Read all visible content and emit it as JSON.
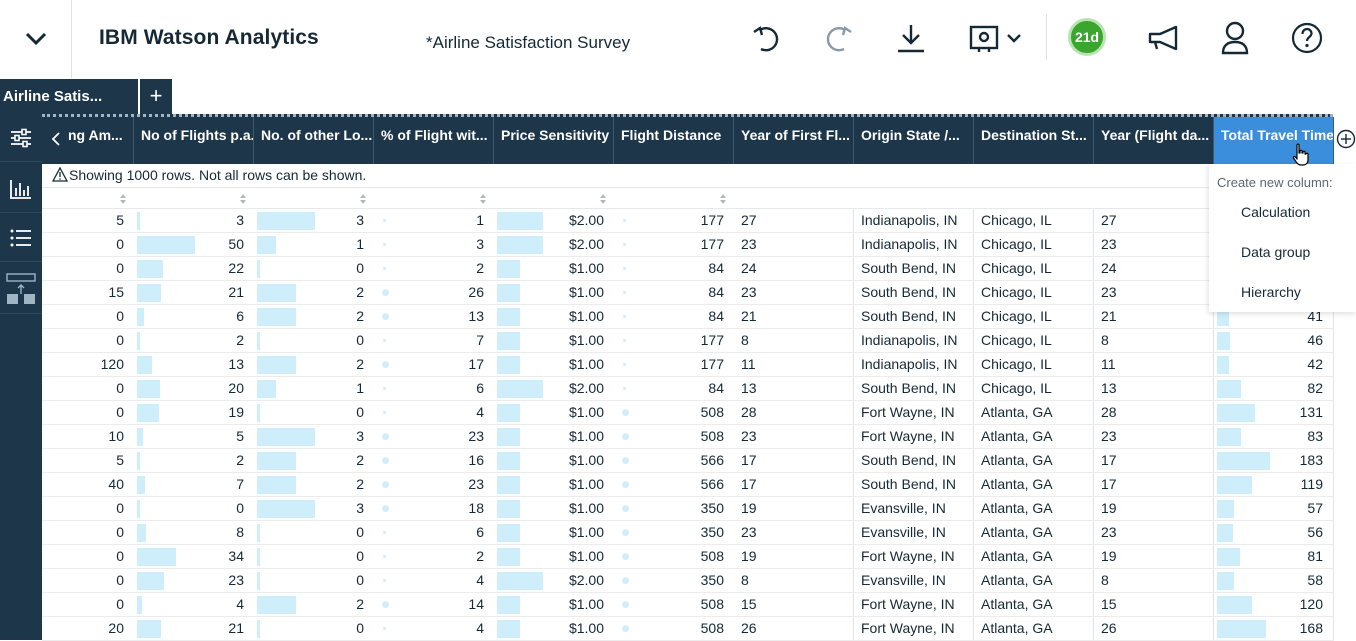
{
  "header": {
    "app_brand": "IBM",
    "app_name": "Watson Analytics",
    "document_title": "*Airline Satisfaction Survey",
    "trial_days": "21d"
  },
  "tabs": {
    "active_label": "Airline Satis...",
    "add_label": "+"
  },
  "grid": {
    "info_message": "Showing 1000 rows. Not all rows can be shown.",
    "columns": [
      "ng Am...",
      "No of Flights p.a.",
      "No. of other Lo...",
      "% of Flight wit...",
      "Price Sensitivity",
      "Flight Distance",
      "Year of First Fl...",
      "Origin State /...",
      "Destination St...",
      "Year (Flight da...",
      "Total Travel Time"
    ],
    "rows": [
      [
        "5",
        "3",
        "3",
        "1",
        "$2.00",
        "177",
        "27",
        "Indianapolis, IN",
        "Chicago, IL",
        "27",
        ""
      ],
      [
        "0",
        "50",
        "1",
        "3",
        "$2.00",
        "177",
        "23",
        "Indianapolis, IN",
        "Chicago, IL",
        "23",
        ""
      ],
      [
        "0",
        "22",
        "0",
        "2",
        "$1.00",
        "84",
        "24",
        "South Bend, IN",
        "Chicago, IL",
        "24",
        ""
      ],
      [
        "15",
        "21",
        "2",
        "26",
        "$1.00",
        "84",
        "23",
        "South Bend, IN",
        "Chicago, IL",
        "23",
        ""
      ],
      [
        "0",
        "6",
        "2",
        "13",
        "$1.00",
        "84",
        "21",
        "South Bend, IN",
        "Chicago, IL",
        "21",
        "41"
      ],
      [
        "0",
        "2",
        "0",
        "7",
        "$1.00",
        "177",
        "8",
        "Indianapolis, IN",
        "Chicago, IL",
        "8",
        "46"
      ],
      [
        "120",
        "13",
        "2",
        "17",
        "$1.00",
        "177",
        "11",
        "Indianapolis, IN",
        "Chicago, IL",
        "11",
        "42"
      ],
      [
        "0",
        "20",
        "1",
        "6",
        "$2.00",
        "84",
        "13",
        "South Bend, IN",
        "Chicago, IL",
        "13",
        "82"
      ],
      [
        "0",
        "19",
        "0",
        "4",
        "$1.00",
        "508",
        "28",
        "Fort Wayne, IN",
        "Atlanta, GA",
        "28",
        "131"
      ],
      [
        "10",
        "5",
        "3",
        "23",
        "$1.00",
        "508",
        "23",
        "Fort Wayne, IN",
        "Atlanta, GA",
        "23",
        "83"
      ],
      [
        "5",
        "2",
        "2",
        "16",
        "$1.00",
        "566",
        "17",
        "South Bend, IN",
        "Atlanta, GA",
        "17",
        "183"
      ],
      [
        "40",
        "7",
        "2",
        "23",
        "$1.00",
        "566",
        "17",
        "South Bend, IN",
        "Atlanta, GA",
        "17",
        "119"
      ],
      [
        "0",
        "0",
        "3",
        "18",
        "$1.00",
        "350",
        "19",
        "Evansville, IN",
        "Atlanta, GA",
        "19",
        "57"
      ],
      [
        "0",
        "8",
        "0",
        "6",
        "$1.00",
        "350",
        "23",
        "Evansville, IN",
        "Atlanta, GA",
        "23",
        "56"
      ],
      [
        "0",
        "34",
        "0",
        "2",
        "$1.00",
        "508",
        "19",
        "Fort Wayne, IN",
        "Atlanta, GA",
        "19",
        "81"
      ],
      [
        "0",
        "23",
        "0",
        "4",
        "$2.00",
        "350",
        "8",
        "Evansville, IN",
        "Atlanta, GA",
        "8",
        "58"
      ],
      [
        "0",
        "4",
        "2",
        "14",
        "$1.00",
        "508",
        "15",
        "Fort Wayne, IN",
        "Atlanta, GA",
        "15",
        "120"
      ],
      [
        "20",
        "21",
        "0",
        "4",
        "$1.00",
        "508",
        "26",
        "Fort Wayne, IN",
        "Atlanta, GA",
        "26",
        "168"
      ]
    ]
  },
  "new_column_menu": {
    "title": "Create new column:",
    "items": [
      "Calculation",
      "Data group",
      "Hierarchy"
    ]
  },
  "colors": {
    "nav_dark": "#1d3649",
    "selected_header": "#3b8edb",
    "bar_fill": "#cdeefa",
    "trial_green": "#3aa52f"
  },
  "icons": {
    "menu": "chevron-down-icon",
    "undo": "undo-icon",
    "redo": "redo-icon",
    "download": "download-icon",
    "present": "presentation-icon",
    "announce": "megaphone-icon",
    "user": "user-icon",
    "help": "help-icon"
  }
}
